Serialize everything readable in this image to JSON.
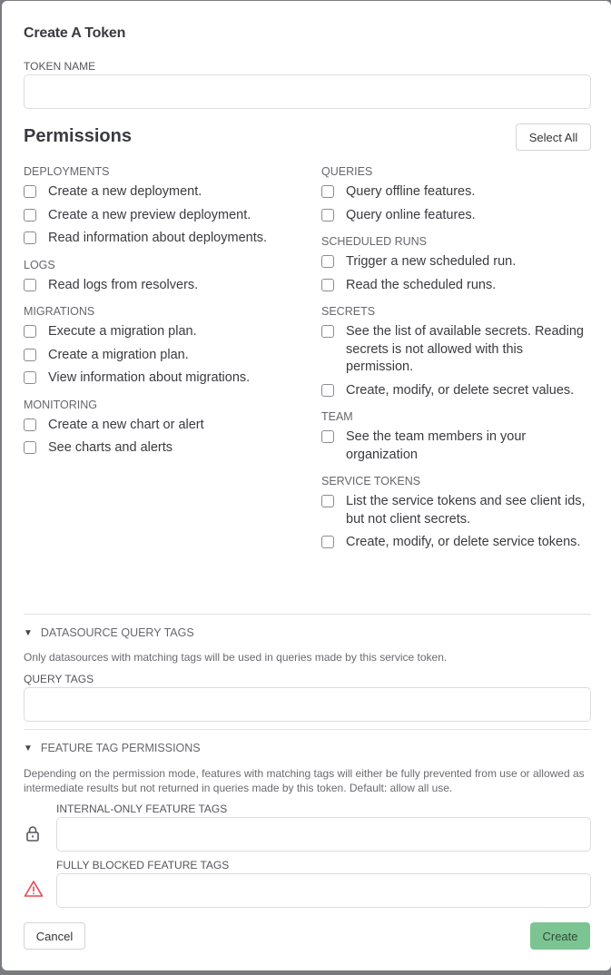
{
  "modal": {
    "title": "Create A Token",
    "token_name": {
      "label": "TOKEN NAME",
      "value": "",
      "placeholder": ""
    },
    "permissions": {
      "title": "Permissions",
      "select_all_label": "Select All",
      "left_groups": [
        {
          "label": "DEPLOYMENTS",
          "items": [
            "Create a new deployment.",
            "Create a new preview deployment.",
            "Read information about deployments."
          ]
        },
        {
          "label": "LOGS",
          "items": [
            "Read logs from resolvers."
          ]
        },
        {
          "label": "MIGRATIONS",
          "items": [
            "Execute a migration plan.",
            "Create a migration plan.",
            "View information about migrations."
          ]
        },
        {
          "label": "MONITORING",
          "items": [
            "Create a new chart or alert",
            "See charts and alerts"
          ]
        }
      ],
      "right_groups": [
        {
          "label": "QUERIES",
          "items": [
            "Query offline features.",
            "Query online features."
          ]
        },
        {
          "label": "SCHEDULED RUNS",
          "items": [
            "Trigger a new scheduled run.",
            "Read the scheduled runs."
          ]
        },
        {
          "label": "SECRETS",
          "items": [
            "See the list of available secrets. Reading secrets is not allowed with this permission.",
            "Create, modify, or delete secret values."
          ]
        },
        {
          "label": "TEAM",
          "items": [
            "See the team members in your organization"
          ]
        },
        {
          "label": "SERVICE TOKENS",
          "items": [
            "List the service tokens and see client ids, but not client secrets.",
            "Create, modify, or delete service tokens."
          ]
        }
      ]
    },
    "datasource_tags": {
      "summary": "DATASOURCE QUERY TAGS",
      "description": "Only datasources with matching tags will be used in queries made by this service token.",
      "field_label": "QUERY TAGS",
      "value": ""
    },
    "feature_tags": {
      "summary": "FEATURE TAG PERMISSIONS",
      "description": "Depending on the permission mode, features with matching tags will either be fully prevented from use or allowed as intermediate results but not returned in queries made by this token. Default: allow all use.",
      "internal_label": "INTERNAL-ONLY FEATURE TAGS",
      "internal_value": "",
      "blocked_label": "FULLY BLOCKED FEATURE TAGS",
      "blocked_value": "",
      "internal_icon": "lock-icon",
      "blocked_icon": "warning-triangle-icon",
      "warning_color": "#e5484d"
    },
    "footer": {
      "cancel_label": "Cancel",
      "create_label": "Create",
      "create_color": "#7cc492"
    }
  }
}
